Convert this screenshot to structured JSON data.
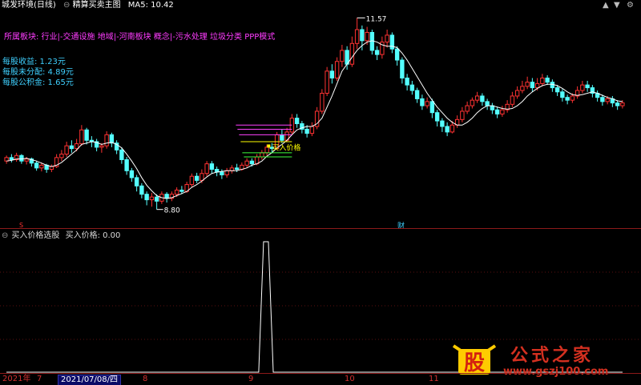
{
  "header": {
    "stock_name": "城发环境(日线)",
    "indicator_name": "精算买卖主图",
    "ma5_label": "MA5: 10.42",
    "circle_icon": "circle-icon"
  },
  "window_controls": {
    "up_icon": "▲",
    "down_icon": "▼",
    "settings_icon": "⚙"
  },
  "sector_info": "所属板块: 行业|-交通设施 地域|-河南板块 概念|-污水处理 垃圾分类 PPP模式",
  "financials": [
    "每股收益: 1.23元",
    "每股未分配: 4.89元",
    "每股公积金: 1.65元"
  ],
  "main_chart": {
    "high_label": "11.57",
    "low_label": "8.80",
    "buy_label": "买入价格",
    "colors": {
      "up": "#ff3232",
      "down": "#54ffff",
      "ma": "#ffffff",
      "yellow": "#ffff00",
      "violet": "#ff40ff",
      "green": "#3cff3c"
    }
  },
  "markers": {
    "fin_marker": "财",
    "s_marker": "S"
  },
  "sub_pane": {
    "title": "买入价格选股",
    "value_label": "买入价格: 0.00"
  },
  "axis": {
    "year": "2021年",
    "labels": [
      "7",
      "8",
      "9",
      "10",
      "11"
    ],
    "selected_date": "2021/07/08/四"
  },
  "watermark": {
    "logo_char": "股",
    "text": "公式之家",
    "url": "www.gszj100.com"
  },
  "chart_data": {
    "type": "line",
    "title": "",
    "xlabel": "",
    "ylabel": "",
    "series": [
      {
        "values": [
          0,
          0,
          0,
          0,
          0,
          0,
          0,
          0,
          0,
          0,
          0,
          0,
          0,
          0,
          0,
          0,
          0,
          0,
          0,
          0,
          0,
          0,
          0,
          0,
          0,
          0,
          0,
          0,
          0,
          0,
          0,
          0,
          0,
          0,
          0,
          0,
          0,
          0,
          0,
          0,
          0,
          0,
          0,
          0,
          0,
          0,
          0,
          0,
          0,
          0,
          0,
          0,
          0,
          1,
          1,
          0,
          0,
          0,
          0,
          0,
          0,
          0,
          0,
          0,
          0,
          0,
          0,
          0,
          0,
          0,
          0,
          0,
          0,
          0,
          0,
          0,
          0,
          0,
          0,
          0,
          0,
          0,
          0,
          0,
          0,
          0,
          0,
          0,
          0,
          0,
          0,
          0,
          0,
          0,
          0,
          0,
          0,
          0,
          0,
          0,
          0,
          0,
          0,
          0,
          0,
          0,
          0,
          0,
          0,
          0,
          0,
          0,
          0,
          0,
          0,
          0,
          0,
          0,
          0,
          0,
          0,
          0,
          0,
          0,
          0,
          0,
          0,
          0
        ]
      }
    ],
    "ylim": [
      0,
      1
    ]
  },
  "candles": [
    [
      9.5,
      9.55,
      9.58,
      9.46
    ],
    [
      9.55,
      9.52,
      9.6,
      9.48
    ],
    [
      9.52,
      9.58,
      9.62,
      9.49
    ],
    [
      9.58,
      9.5,
      9.6,
      9.46
    ],
    [
      9.5,
      9.53,
      9.56,
      9.45
    ],
    [
      9.53,
      9.47,
      9.55,
      9.42
    ],
    [
      9.47,
      9.4,
      9.5,
      9.36
    ],
    [
      9.4,
      9.44,
      9.48,
      9.35
    ],
    [
      9.44,
      9.38,
      9.46,
      9.33
    ],
    [
      9.38,
      9.42,
      9.45,
      9.34
    ],
    [
      9.42,
      9.55,
      9.6,
      9.4
    ],
    [
      9.55,
      9.6,
      9.66,
      9.5
    ],
    [
      9.6,
      9.72,
      9.78,
      9.56
    ],
    [
      9.72,
      9.68,
      9.8,
      9.62
    ],
    [
      9.68,
      9.75,
      9.82,
      9.64
    ],
    [
      9.75,
      9.95,
      10.02,
      9.72
    ],
    [
      9.95,
      9.8,
      9.98,
      9.74
    ],
    [
      9.8,
      9.78,
      9.86,
      9.7
    ],
    [
      9.78,
      9.7,
      9.82,
      9.64
    ],
    [
      9.7,
      9.72,
      9.76,
      9.62
    ],
    [
      9.72,
      9.88,
      9.93,
      9.68
    ],
    [
      9.88,
      9.76,
      9.91,
      9.7
    ],
    [
      9.76,
      9.66,
      9.8,
      9.6
    ],
    [
      9.66,
      9.52,
      9.7,
      9.46
    ],
    [
      9.52,
      9.36,
      9.56,
      9.3
    ],
    [
      9.36,
      9.26,
      9.4,
      9.2
    ],
    [
      9.26,
      9.14,
      9.3,
      9.06
    ],
    [
      9.14,
      9.02,
      9.18,
      8.96
    ],
    [
      9.02,
      8.94,
      9.06,
      8.86
    ],
    [
      8.94,
      8.98,
      9.04,
      8.84
    ],
    [
      8.98,
      8.92,
      9.02,
      8.8
    ],
    [
      8.92,
      9.02,
      9.06,
      8.88
    ],
    [
      9.02,
      8.96,
      9.05,
      8.9
    ],
    [
      8.96,
      9.02,
      9.06,
      8.92
    ],
    [
      9.02,
      9.08,
      9.12,
      8.98
    ],
    [
      9.08,
      9.06,
      9.14,
      9.02
    ],
    [
      9.06,
      9.16,
      9.2,
      9.04
    ],
    [
      9.16,
      9.28,
      9.32,
      9.12
    ],
    [
      9.28,
      9.22,
      9.33,
      9.18
    ],
    [
      9.22,
      9.32,
      9.38,
      9.18
    ],
    [
      9.32,
      9.46,
      9.5,
      9.28
    ],
    [
      9.46,
      9.38,
      9.5,
      9.32
    ],
    [
      9.38,
      9.34,
      9.42,
      9.28
    ],
    [
      9.34,
      9.3,
      9.38,
      9.24
    ],
    [
      9.3,
      9.36,
      9.4,
      9.26
    ],
    [
      9.36,
      9.4,
      9.44,
      9.32
    ],
    [
      9.4,
      9.38,
      9.46,
      9.34
    ],
    [
      9.38,
      9.44,
      9.48,
      9.36
    ],
    [
      9.44,
      9.5,
      9.54,
      9.4
    ],
    [
      9.5,
      9.46,
      9.54,
      9.42
    ],
    [
      9.46,
      9.56,
      9.6,
      9.44
    ],
    [
      9.56,
      9.62,
      9.66,
      9.52
    ],
    [
      9.62,
      9.7,
      9.74,
      9.58
    ],
    [
      9.7,
      9.68,
      9.76,
      9.62
    ],
    [
      9.68,
      9.88,
      9.92,
      9.66
    ],
    [
      9.88,
      9.8,
      9.96,
      9.76
    ],
    [
      9.8,
      9.92,
      9.98,
      9.78
    ],
    [
      9.92,
      10.12,
      10.18,
      9.88
    ],
    [
      10.12,
      10.04,
      10.18,
      9.98
    ],
    [
      10.04,
      9.96,
      10.08,
      9.9
    ],
    [
      9.96,
      9.9,
      10.02,
      9.84
    ],
    [
      9.9,
      10.0,
      10.06,
      9.86
    ],
    [
      10.0,
      10.22,
      10.28,
      9.96
    ],
    [
      10.22,
      10.48,
      10.54,
      10.18
    ],
    [
      10.48,
      10.8,
      10.86,
      10.44
    ],
    [
      10.8,
      10.7,
      10.9,
      10.62
    ],
    [
      10.7,
      10.94,
      11.0,
      10.66
    ],
    [
      10.94,
      11.1,
      11.18,
      10.86
    ],
    [
      11.1,
      10.9,
      11.16,
      10.82
    ],
    [
      10.9,
      11.2,
      11.3,
      10.86
    ],
    [
      11.2,
      11.4,
      11.57,
      11.12
    ],
    [
      11.4,
      11.24,
      11.46,
      11.1
    ],
    [
      11.24,
      11.36,
      11.44,
      11.18
    ],
    [
      11.36,
      11.1,
      11.4,
      11.04
    ],
    [
      11.1,
      11.04,
      11.16,
      10.96
    ],
    [
      11.04,
      11.22,
      11.3,
      10.98
    ],
    [
      11.22,
      11.32,
      11.4,
      11.14
    ],
    [
      11.32,
      11.12,
      11.36,
      11.06
    ],
    [
      11.12,
      10.96,
      11.16,
      10.88
    ],
    [
      10.96,
      10.7,
      11.0,
      10.62
    ],
    [
      10.7,
      10.6,
      10.76,
      10.52
    ],
    [
      10.6,
      10.52,
      10.66,
      10.46
    ],
    [
      10.52,
      10.4,
      10.56,
      10.34
    ],
    [
      10.4,
      10.3,
      10.46,
      10.24
    ],
    [
      10.3,
      10.36,
      10.42,
      10.26
    ],
    [
      10.36,
      10.2,
      10.4,
      10.12
    ],
    [
      10.2,
      10.08,
      10.24,
      10.0
    ],
    [
      10.08,
      10.0,
      10.12,
      9.92
    ],
    [
      10.0,
      9.92,
      10.06,
      9.86
    ],
    [
      9.92,
      10.02,
      10.08,
      9.9
    ],
    [
      10.02,
      10.1,
      10.16,
      9.98
    ],
    [
      10.1,
      10.22,
      10.28,
      10.06
    ],
    [
      10.22,
      10.3,
      10.36,
      10.18
    ],
    [
      10.3,
      10.38,
      10.42,
      10.26
    ],
    [
      10.38,
      10.44,
      10.5,
      10.34
    ],
    [
      10.44,
      10.36,
      10.48,
      10.3
    ],
    [
      10.36,
      10.3,
      10.4,
      10.24
    ],
    [
      10.3,
      10.24,
      10.34,
      10.18
    ],
    [
      10.24,
      10.18,
      10.28,
      10.12
    ],
    [
      10.18,
      10.24,
      10.3,
      10.14
    ],
    [
      10.24,
      10.32,
      10.38,
      10.2
    ],
    [
      10.32,
      10.44,
      10.5,
      10.28
    ],
    [
      10.44,
      10.52,
      10.58,
      10.4
    ],
    [
      10.52,
      10.58,
      10.66,
      10.48
    ],
    [
      10.58,
      10.64,
      10.72,
      10.54
    ],
    [
      10.64,
      10.56,
      10.7,
      10.5
    ],
    [
      10.56,
      10.62,
      10.7,
      10.52
    ],
    [
      10.62,
      10.7,
      10.76,
      10.58
    ],
    [
      10.7,
      10.64,
      10.74,
      10.6
    ],
    [
      10.64,
      10.56,
      10.68,
      10.5
    ],
    [
      10.56,
      10.5,
      10.6,
      10.44
    ],
    [
      10.5,
      10.42,
      10.54,
      10.36
    ],
    [
      10.42,
      10.38,
      10.46,
      10.32
    ],
    [
      10.38,
      10.44,
      10.48,
      10.34
    ],
    [
      10.44,
      10.52,
      10.58,
      10.4
    ],
    [
      10.52,
      10.6,
      10.66,
      10.48
    ],
    [
      10.6,
      10.56,
      10.66,
      10.5
    ],
    [
      10.56,
      10.48,
      10.6,
      10.42
    ],
    [
      10.48,
      10.42,
      10.52,
      10.36
    ],
    [
      10.42,
      10.36,
      10.46,
      10.3
    ],
    [
      10.36,
      10.4,
      10.44,
      10.32
    ],
    [
      10.4,
      10.34,
      10.44,
      10.28
    ],
    [
      10.34,
      10.3,
      10.38,
      10.24
    ],
    [
      10.3,
      10.34,
      10.38,
      10.26
    ]
  ],
  "ma5": [
    9.5,
    9.51,
    9.53,
    9.53,
    9.54,
    9.52,
    9.5,
    9.47,
    9.44,
    9.42,
    9.44,
    9.48,
    9.54,
    9.6,
    9.66,
    9.74,
    9.76,
    9.78,
    9.77,
    9.74,
    9.76,
    9.77,
    9.74,
    9.69,
    9.6,
    9.5,
    9.39,
    9.26,
    9.15,
    9.07,
    9.0,
    8.97,
    8.96,
    8.97,
    9.0,
    9.03,
    9.06,
    9.12,
    9.16,
    9.21,
    9.27,
    9.32,
    9.34,
    9.35,
    9.36,
    9.36,
    9.36,
    9.38,
    9.4,
    9.44,
    9.46,
    9.5,
    9.57,
    9.62,
    9.69,
    9.74,
    9.8,
    9.88,
    9.95,
    9.98,
    10.0,
    10.0,
    10.04,
    10.12,
    10.28,
    10.44,
    10.62,
    10.8,
    10.9,
    11.0,
    11.1,
    11.17,
    11.22,
    11.24,
    11.22,
    11.18,
    11.16,
    11.16,
    11.14,
    11.06,
    10.96,
    10.84,
    10.72,
    10.6,
    10.48,
    10.38,
    10.28,
    10.2,
    10.12,
    10.06,
    10.02,
    10.02,
    10.06,
    10.12,
    10.2,
    10.26,
    10.3,
    10.3,
    10.28,
    10.26,
    10.25,
    10.26,
    10.3,
    10.36,
    10.44,
    10.5,
    10.55,
    10.59,
    10.61,
    10.61,
    10.59,
    10.55,
    10.5,
    10.46,
    10.45,
    10.46,
    10.48,
    10.5,
    10.48,
    10.45,
    10.42,
    10.4,
    10.37,
    10.36
  ]
}
